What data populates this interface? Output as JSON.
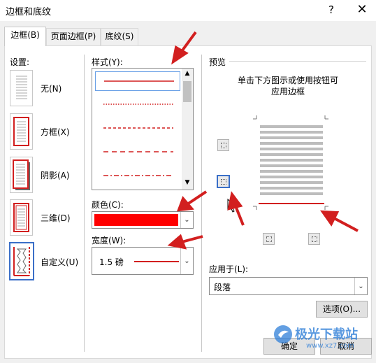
{
  "window": {
    "title": "边框和底纹",
    "help": "?",
    "close": "✕"
  },
  "tabs": [
    {
      "label": "边框(B)",
      "active": true
    },
    {
      "label": "页面边框(P)",
      "active": false
    },
    {
      "label": "底纹(S)",
      "active": false
    }
  ],
  "settings": {
    "label": "设置:",
    "items": [
      {
        "label": "无(N)",
        "icon": "setting-none-icon"
      },
      {
        "label": "方框(X)",
        "icon": "setting-box-icon"
      },
      {
        "label": "阴影(A)",
        "icon": "setting-shadow-icon"
      },
      {
        "label": "三维(D)",
        "icon": "setting-3d-icon"
      },
      {
        "label": "自定义(U)",
        "icon": "setting-custom-icon",
        "selected": true
      }
    ]
  },
  "style": {
    "label": "样式(Y):",
    "items": [
      "solid",
      "dotted",
      "dashed-small",
      "dashed",
      "dash-dot"
    ]
  },
  "color": {
    "label": "颜色(C):",
    "value": "#ff0000"
  },
  "width": {
    "label": "宽度(W):",
    "value": "1.5 磅"
  },
  "preview": {
    "label": "预览",
    "hint_line1": "单击下方图示或使用按钮可",
    "hint_line2": "应用边框"
  },
  "apply_to": {
    "label": "应用于(L):",
    "value": "段落"
  },
  "buttons": {
    "options": "选项(O)...",
    "ok": "确定",
    "cancel": "取消"
  },
  "watermark": {
    "text": "极光下载站",
    "url": "www.xz7.com"
  },
  "colors": {
    "accent": "#d21f1f",
    "selection": "#3a6fc8"
  }
}
